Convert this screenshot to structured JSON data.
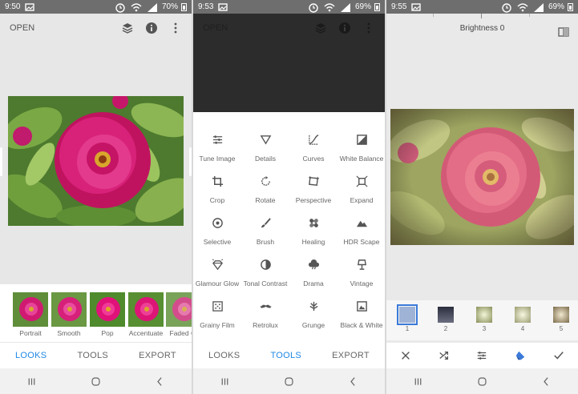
{
  "colors": {
    "accent": "#1e88e5",
    "status_bar": "#6e6e6e",
    "peony": "#d0166f",
    "leaf": "#4f8a2c"
  },
  "screen1": {
    "status": {
      "time": "9:50",
      "battery": "70%"
    },
    "topbar": {
      "open_label": "OPEN"
    },
    "looks": [
      {
        "label": "Portrait"
      },
      {
        "label": "Smooth"
      },
      {
        "label": "Pop"
      },
      {
        "label": "Accentuate"
      },
      {
        "label": "Faded Gl"
      }
    ],
    "tabs": [
      {
        "label": "LOOKS"
      },
      {
        "label": "TOOLS"
      },
      {
        "label": "EXPORT"
      }
    ],
    "active_tab": "LOOKS"
  },
  "screen2": {
    "status": {
      "time": "9:53",
      "battery": "69%"
    },
    "topbar": {
      "open_label": "OPEN"
    },
    "tools": [
      {
        "label": "Tune Image",
        "icon": "sliders-icon"
      },
      {
        "label": "Details",
        "icon": "triangle-icon"
      },
      {
        "label": "Curves",
        "icon": "curves-icon"
      },
      {
        "label": "White Balance",
        "icon": "white-balance-icon"
      },
      {
        "label": "Crop",
        "icon": "crop-icon"
      },
      {
        "label": "Rotate",
        "icon": "rotate-icon"
      },
      {
        "label": "Perspective",
        "icon": "perspective-icon"
      },
      {
        "label": "Expand",
        "icon": "expand-icon"
      },
      {
        "label": "Selective",
        "icon": "target-icon"
      },
      {
        "label": "Brush",
        "icon": "brush-icon"
      },
      {
        "label": "Healing",
        "icon": "bandage-icon"
      },
      {
        "label": "HDR Scape",
        "icon": "mountain-icon"
      },
      {
        "label": "Glamour Glow",
        "icon": "diamond-icon"
      },
      {
        "label": "Tonal Contrast",
        "icon": "half-circle-icon"
      },
      {
        "label": "Drama",
        "icon": "cloud-icon"
      },
      {
        "label": "Vintage",
        "icon": "lamp-icon"
      },
      {
        "label": "Grainy Film",
        "icon": "dots-square-icon"
      },
      {
        "label": "Retrolux",
        "icon": "mustache-icon"
      },
      {
        "label": "Grunge",
        "icon": "grunge-icon"
      },
      {
        "label": "Black & White",
        "icon": "bw-icon"
      }
    ],
    "tabs": [
      {
        "label": "LOOKS"
      },
      {
        "label": "TOOLS"
      },
      {
        "label": "EXPORT"
      }
    ],
    "active_tab": "TOOLS"
  },
  "screen3": {
    "status": {
      "time": "9:55",
      "battery": "69%"
    },
    "adjustment": {
      "label": "Brightness 0"
    },
    "variants": [
      {
        "number": "1",
        "color": "#9fb3d6"
      },
      {
        "number": "2",
        "color": "#2b2e3d"
      },
      {
        "number": "3",
        "color": "#e4ecc2"
      },
      {
        "number": "4",
        "color": "#eef0d0"
      },
      {
        "number": "5",
        "color": "#e6dbc0"
      }
    ],
    "selected_variant": "1"
  }
}
